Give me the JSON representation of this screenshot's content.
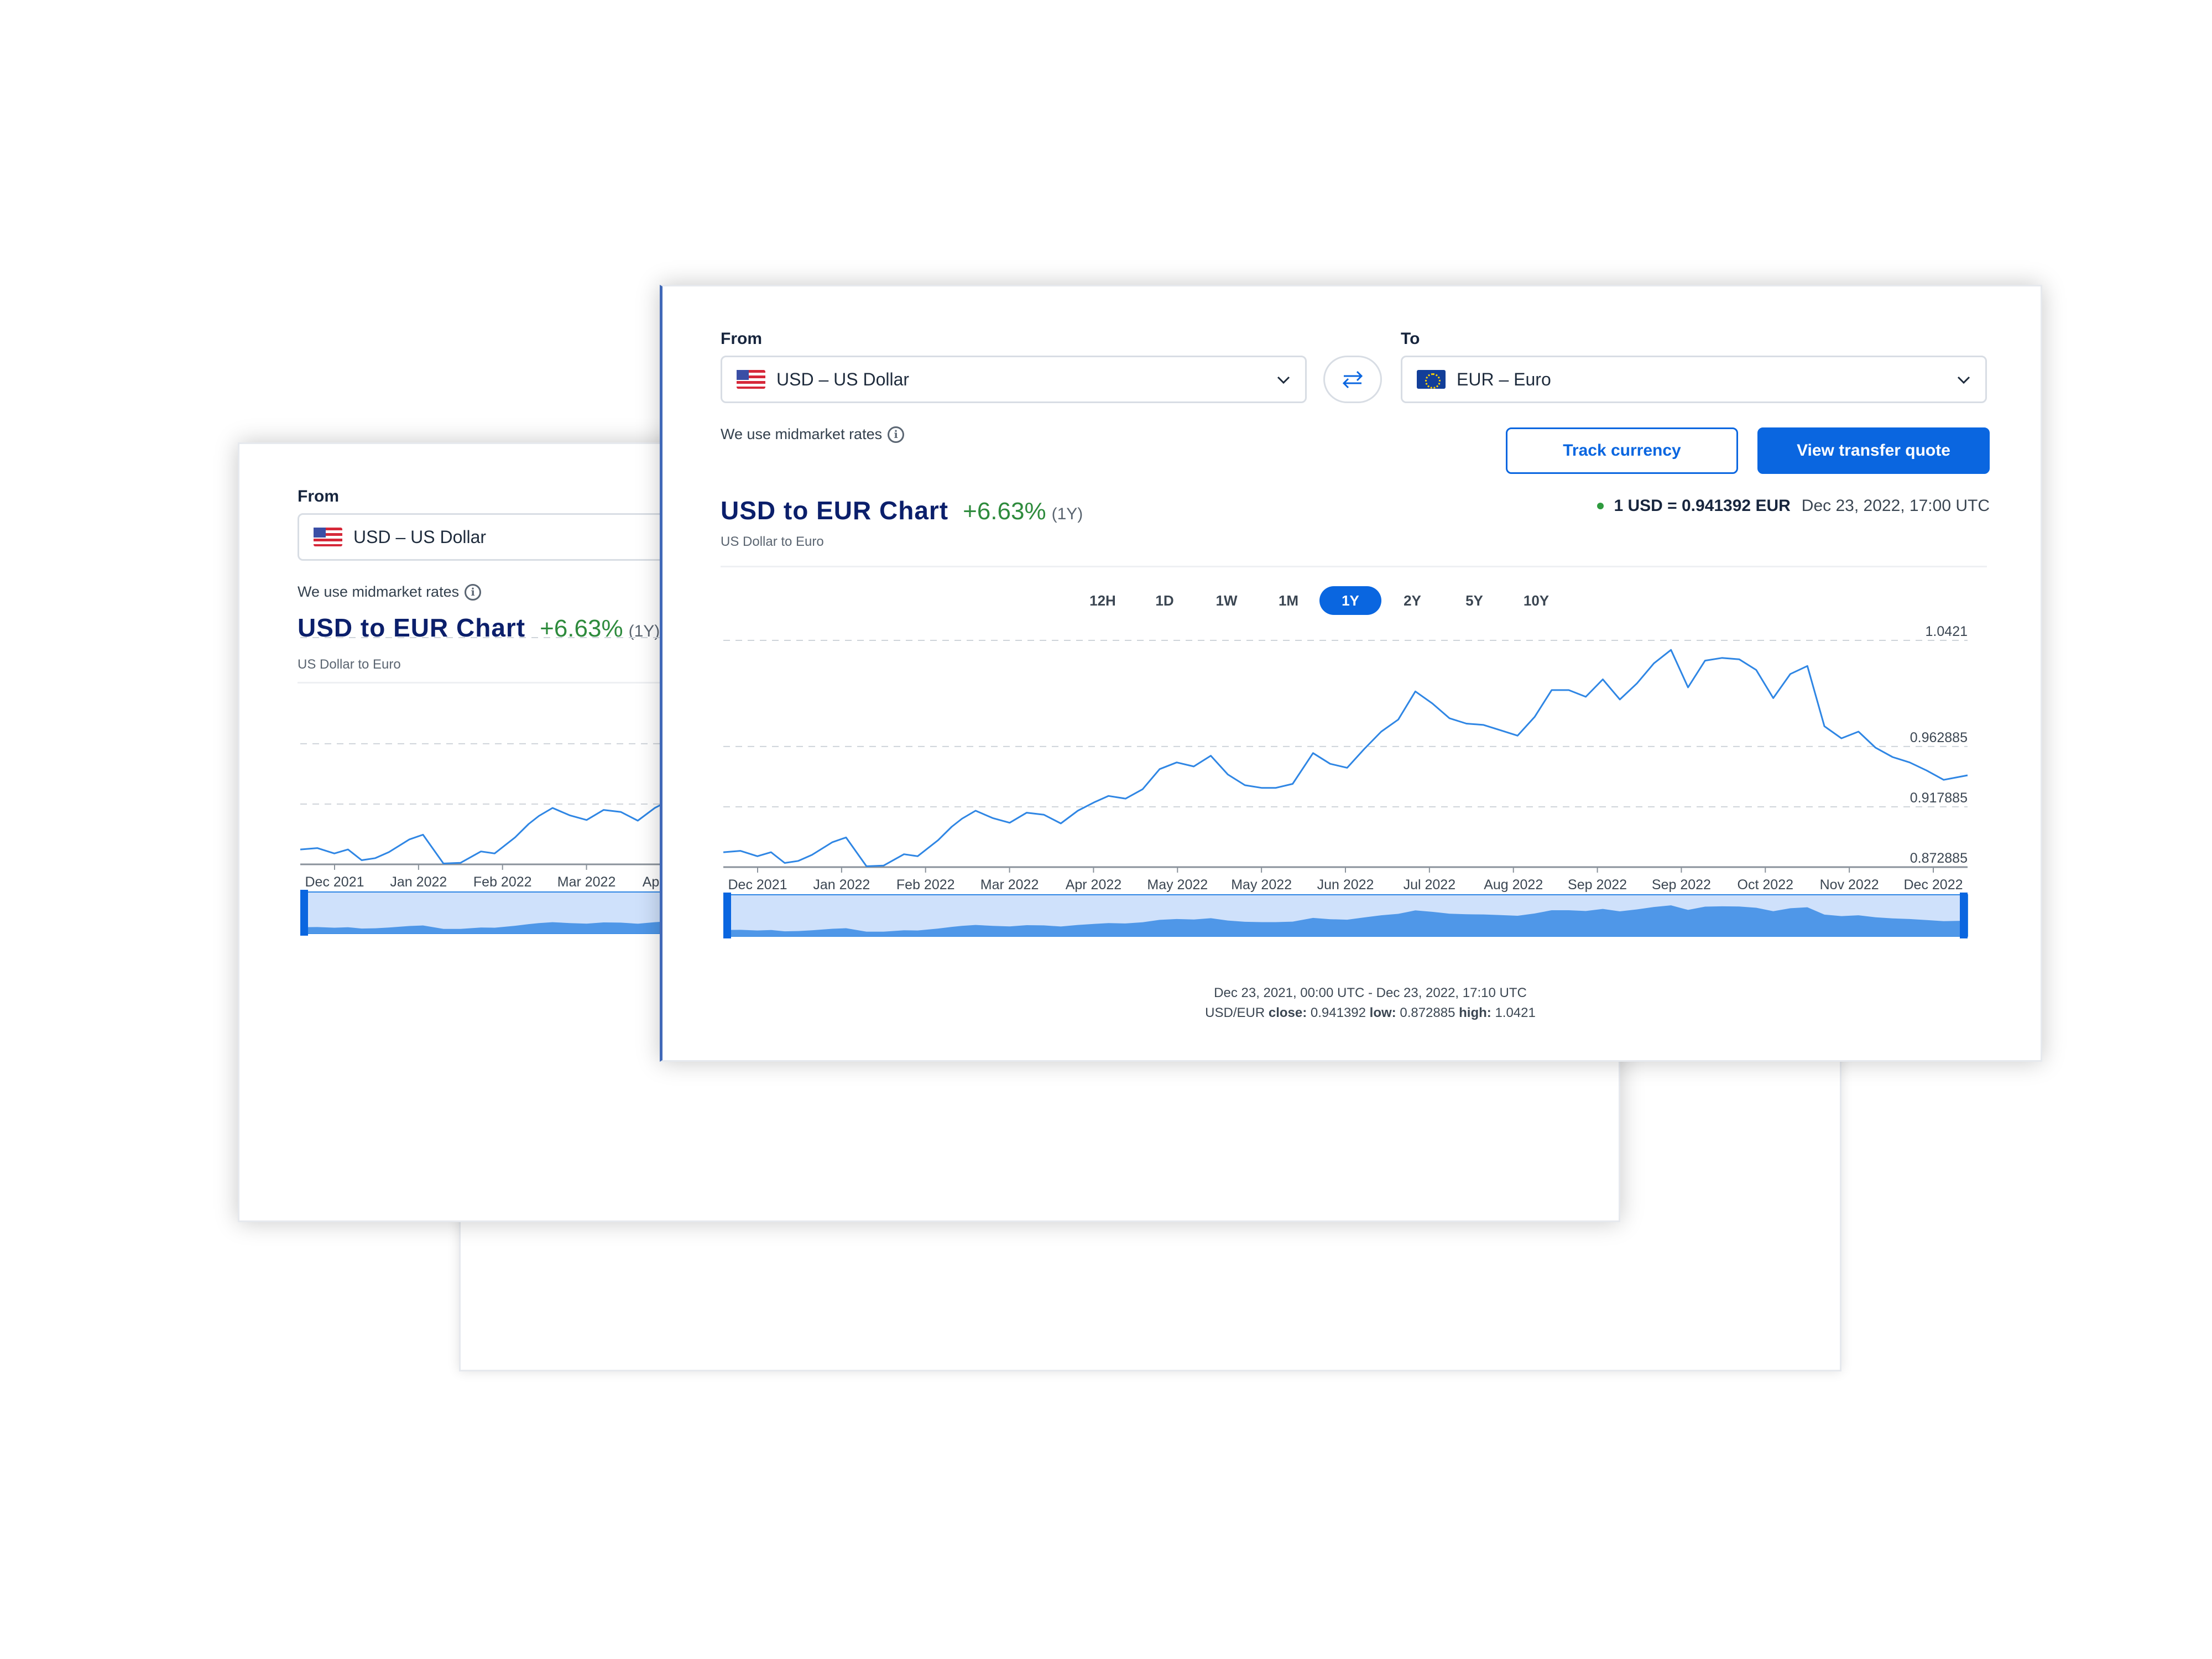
{
  "converter": {
    "from_label": "From",
    "to_label": "To",
    "from_value": "USD – US Dollar",
    "to_value": "EUR – Euro",
    "from_flag_icon": "us-flag-icon",
    "to_flag_icon": "eu-flag-icon",
    "swap_icon": "swap-arrows-icon"
  },
  "midmarket_note": "We use midmarket rates",
  "buttons": {
    "track": "Track currency",
    "quote": "View transfer quote"
  },
  "chart_header": {
    "title": "USD to EUR Chart",
    "change": "+6.63%",
    "period": "(1Y)",
    "subtitle": "US Dollar to Euro",
    "rate": "1 USD = 0.941392 EUR",
    "timestamp": "Dec 23, 2022, 17:00 UTC"
  },
  "timeframes": [
    "12H",
    "1D",
    "1W",
    "1M",
    "1Y",
    "2Y",
    "5Y",
    "10Y"
  ],
  "active_timeframe": "1Y",
  "footer": {
    "range": "Dec 23, 2021, 00:00 UTC - Dec 23, 2022, 17:10 UTC",
    "pair": "USD/EUR",
    "close_label": "close:",
    "close": "0.941392",
    "low_label": "low:",
    "low": "0.872885",
    "high_label": "high:",
    "high": "1.0421"
  },
  "colors": {
    "accent": "#0a66e0",
    "title": "#0b1f6b",
    "positive": "#2e8b3d",
    "line": "#2f86e4",
    "navigator_fill": "#4f97e8"
  },
  "chart_data": {
    "type": "line",
    "title": "USD to EUR Chart",
    "x_tick_labels": [
      "Dec 2021",
      "Jan 2022",
      "Feb 2022",
      "Mar 2022",
      "Apr 2022",
      "May 2022",
      "May 2022",
      "Jun 2022",
      "Jul 2022",
      "Aug 2022",
      "Sep 2022",
      "Sep 2022",
      "Oct 2022",
      "Nov 2022",
      "Dec 2022"
    ],
    "y_tick_labels": [
      "1.0421",
      "0.962885",
      "0.917885",
      "0.872885"
    ],
    "y_ticks": [
      1.0421,
      0.962885,
      0.917885,
      0.872885
    ],
    "ylim": [
      0.872885,
      1.0421
    ],
    "grid": "horizontal dashed",
    "series": [
      {
        "x": [
          "2021-12-23",
          "2021-12-28",
          "2022-01-02",
          "2022-01-06",
          "2022-01-10",
          "2022-01-14",
          "2022-01-18",
          "2022-01-24",
          "2022-01-28",
          "2022-02-03",
          "2022-02-08",
          "2022-02-14",
          "2022-02-18",
          "2022-02-24",
          "2022-02-28",
          "2022-03-03",
          "2022-03-07",
          "2022-03-12",
          "2022-03-17",
          "2022-03-22",
          "2022-03-27",
          "2022-04-01",
          "2022-04-06",
          "2022-04-11",
          "2022-04-15",
          "2022-04-20",
          "2022-04-25",
          "2022-04-30",
          "2022-05-05",
          "2022-05-10",
          "2022-05-15",
          "2022-05-20",
          "2022-05-25",
          "2022-05-30",
          "2022-06-03",
          "2022-06-08",
          "2022-06-14",
          "2022-06-19",
          "2022-06-24",
          "2022-06-29",
          "2022-07-04",
          "2022-07-09",
          "2022-07-14",
          "2022-07-19",
          "2022-07-24",
          "2022-07-29",
          "2022-08-03",
          "2022-08-08",
          "2022-08-13",
          "2022-08-18",
          "2022-08-23",
          "2022-08-28",
          "2022-09-02",
          "2022-09-07",
          "2022-09-12",
          "2022-09-17",
          "2022-09-22",
          "2022-09-27",
          "2022-10-02",
          "2022-10-07",
          "2022-10-12",
          "2022-10-17",
          "2022-10-22",
          "2022-10-27",
          "2022-11-01",
          "2022-11-06",
          "2022-11-11",
          "2022-11-16",
          "2022-11-21",
          "2022-11-26",
          "2022-12-01",
          "2022-12-06",
          "2022-12-11",
          "2022-12-16",
          "2022-12-23"
        ],
        "y": [
          0.884,
          0.885,
          0.881,
          0.884,
          0.876,
          0.8775,
          0.882,
          0.8915,
          0.895,
          0.8735,
          0.874,
          0.8825,
          0.881,
          0.893,
          0.903,
          0.909,
          0.915,
          0.9095,
          0.906,
          0.9135,
          0.912,
          0.9055,
          0.915,
          0.9215,
          0.926,
          0.924,
          0.931,
          0.946,
          0.951,
          0.948,
          0.956,
          0.942,
          0.934,
          0.932,
          0.932,
          0.935,
          0.958,
          0.95,
          0.947,
          0.961,
          0.974,
          0.983,
          1.004,
          0.995,
          0.984,
          0.98,
          0.979,
          0.975,
          0.971,
          0.985,
          1.005,
          1.005,
          1.0,
          1.013,
          0.998,
          1.01,
          1.025,
          1.035,
          1.007,
          1.027,
          1.029,
          1.028,
          1.02,
          0.999,
          1.017,
          1.023,
          0.978,
          0.969,
          0.974,
          0.962,
          0.955,
          0.951,
          0.945,
          0.938,
          0.9414
        ]
      }
    ],
    "navigator_range": [
      "Dec 23, 2021, 00:00 UTC",
      "Dec 23, 2022, 17:10 UTC"
    ]
  }
}
